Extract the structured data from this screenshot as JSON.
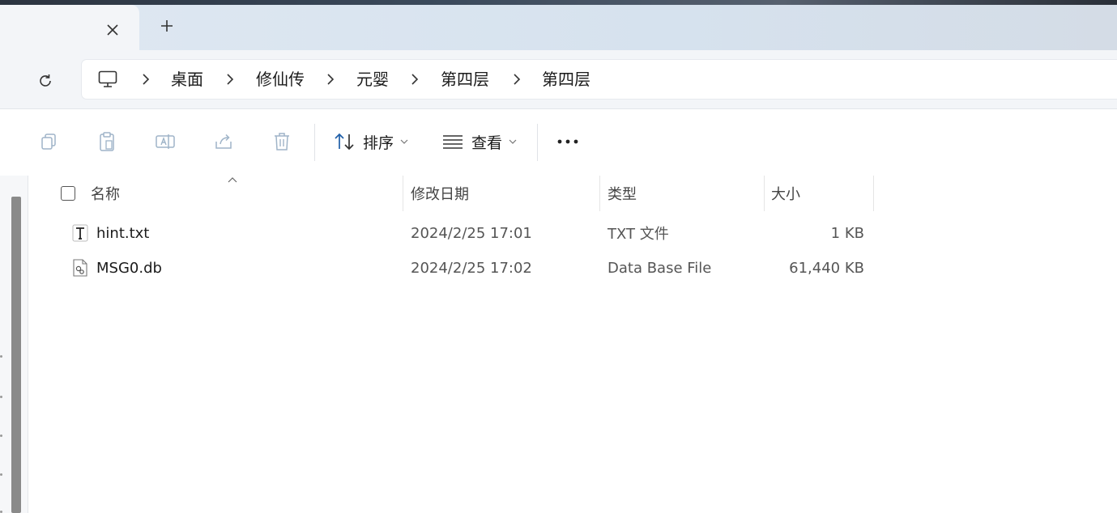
{
  "window": {
    "tab_close_icon": "close-icon",
    "new_tab_icon": "plus-icon"
  },
  "address": {
    "refresh_icon": "refresh-icon",
    "root_icon": "computer-icon",
    "breadcrumbs": [
      "桌面",
      "修仙传",
      "元婴",
      "第四层",
      "第四层"
    ]
  },
  "toolbar": {
    "copy_icon": "copy-icon",
    "paste_icon": "paste-icon",
    "rename_icon": "rename-icon",
    "share_icon": "share-icon",
    "delete_icon": "trash-icon",
    "sort_label": "排序",
    "view_label": "查看",
    "more_icon": "more-icon"
  },
  "columns": {
    "name": "名称",
    "modified": "修改日期",
    "type": "类型",
    "size": "大小"
  },
  "files": [
    {
      "icon": "text-file-icon",
      "name": "hint.txt",
      "modified": "2024/2/25 17:01",
      "type": "TXT 文件",
      "size": "1 KB"
    },
    {
      "icon": "db-file-icon",
      "name": "MSG0.db",
      "modified": "2024/2/25 17:02",
      "type": "Data Base File",
      "size": "61,440 KB"
    }
  ]
}
